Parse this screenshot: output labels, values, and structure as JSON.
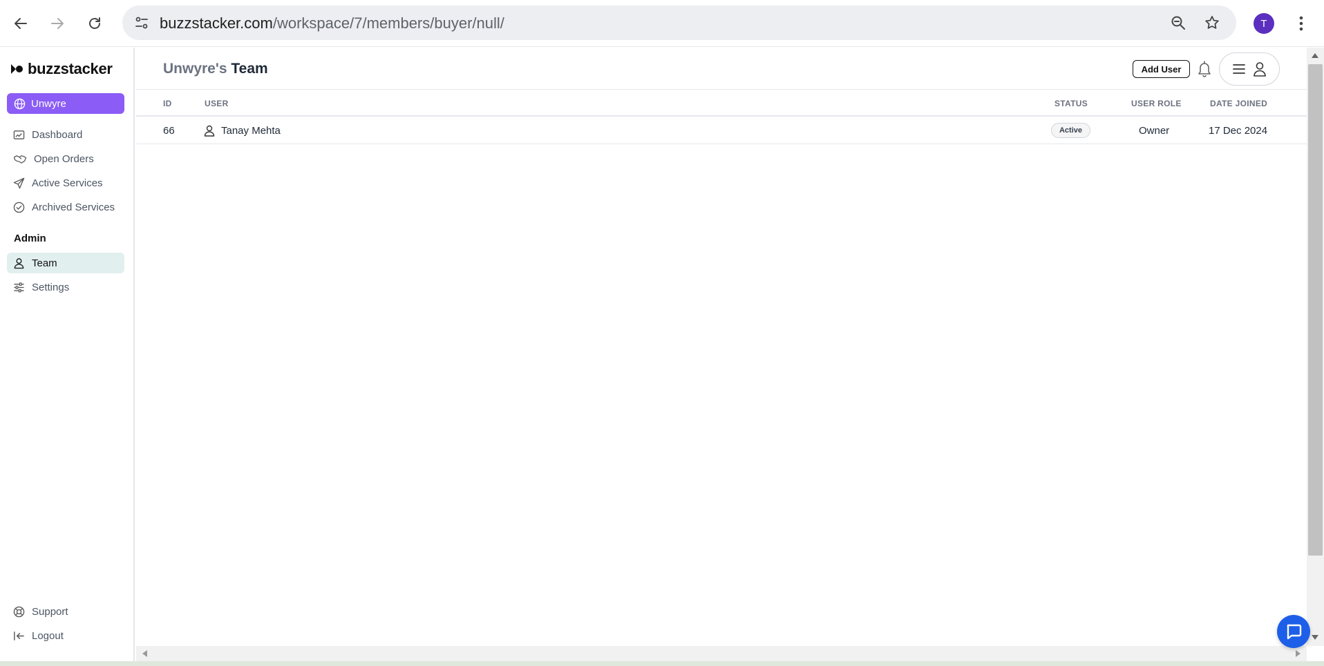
{
  "browser": {
    "url_host": "buzzstacker.com",
    "url_path": "/workspace/7/members/buyer/null/",
    "profile_initial": "T"
  },
  "sidebar": {
    "brand": "buzzstacker",
    "workspace": "Unwyre",
    "items": [
      {
        "label": "Dashboard",
        "icon": "dashboard-icon"
      },
      {
        "label": "Open Orders",
        "icon": "handshake-icon"
      },
      {
        "label": "Active Services",
        "icon": "paper-plane-icon"
      },
      {
        "label": "Archived Services",
        "icon": "check-circle-icon"
      }
    ],
    "admin_label": "Admin",
    "admin_items": [
      {
        "label": "Team",
        "icon": "user-icon",
        "active": true
      },
      {
        "label": "Settings",
        "icon": "sliders-icon"
      }
    ],
    "footer_items": [
      {
        "label": "Support",
        "icon": "lifebuoy-icon"
      },
      {
        "label": "Logout",
        "icon": "logout-icon"
      }
    ]
  },
  "header": {
    "title_workspace": "Unwyre's",
    "title_page": "Team",
    "add_user_label": "Add User"
  },
  "table": {
    "columns": {
      "id": "ID",
      "user": "USER",
      "status": "STATUS",
      "role": "USER ROLE",
      "joined": "DATE JOINED"
    },
    "rows": [
      {
        "id": "66",
        "user": "Tanay Mehta",
        "status": "Active",
        "role": "Owner",
        "joined": "17 Dec 2024"
      }
    ]
  },
  "colors": {
    "accent": "#8b5cf6",
    "active_nav": "#e1efef",
    "chat": "#1d5fe8",
    "profile": "#5b2fbf"
  }
}
